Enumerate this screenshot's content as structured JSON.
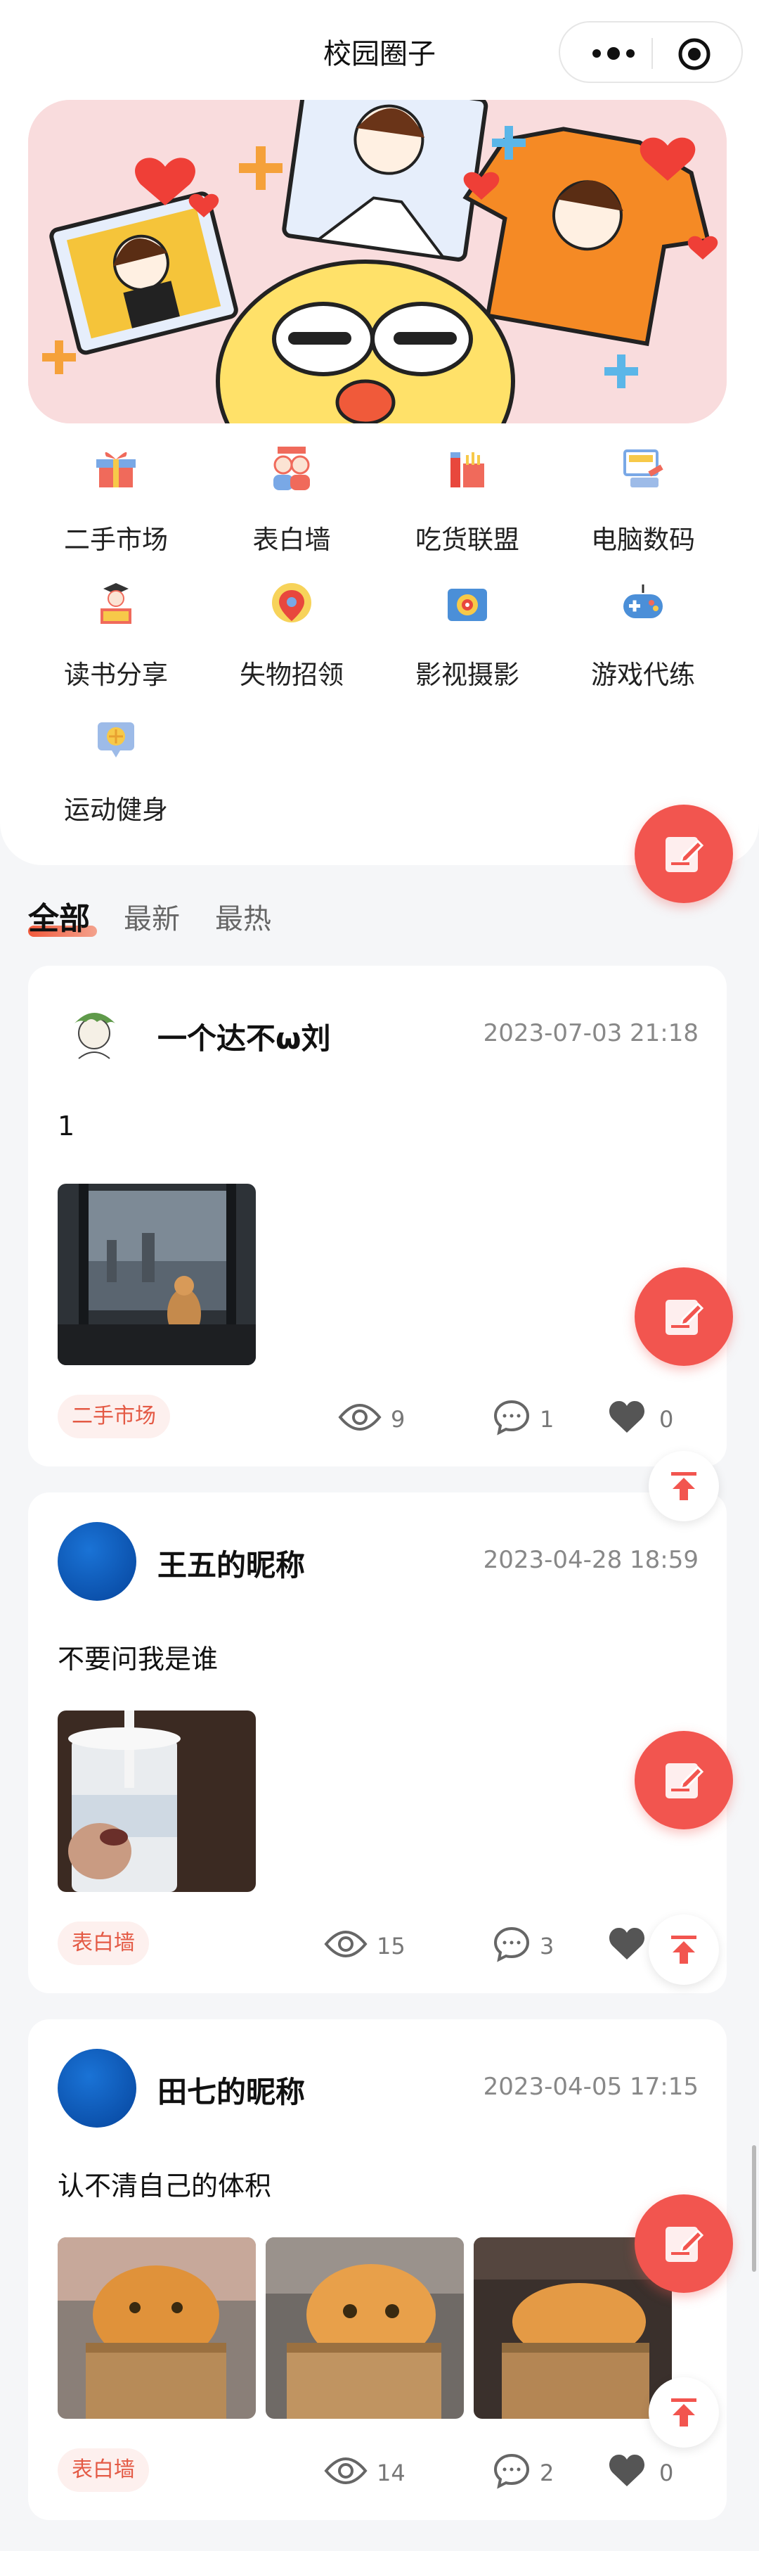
{
  "app": {
    "title": "校园圈子"
  },
  "categories": [
    {
      "label": "二手市场",
      "icon": "gift-icon"
    },
    {
      "label": "表白墙",
      "icon": "couple-icon"
    },
    {
      "label": "吃货联盟",
      "icon": "food-icon"
    },
    {
      "label": "电脑数码",
      "icon": "computer-icon"
    },
    {
      "label": "读书分享",
      "icon": "book-icon"
    },
    {
      "label": "失物招领",
      "icon": "location-icon"
    },
    {
      "label": "影视摄影",
      "icon": "camera-icon"
    },
    {
      "label": "游戏代练",
      "icon": "gamepad-icon"
    },
    {
      "label": "运动健身",
      "icon": "fitness-icon"
    }
  ],
  "tabs": [
    {
      "label": "全部",
      "active": true
    },
    {
      "label": "最新",
      "active": false
    },
    {
      "label": "最热",
      "active": false
    }
  ],
  "posts": [
    {
      "name": "一个达不ω刘",
      "date": "2023-07-03 21:18",
      "content": "1",
      "tag": "二手市场",
      "views": "9",
      "comments": "1",
      "likes": "0"
    },
    {
      "name": "王五的昵称",
      "date": "2023-04-28 18:59",
      "content": "不要问我是谁",
      "tag": "表白墙",
      "views": "15",
      "comments": "3",
      "likes": ""
    },
    {
      "name": "田七的昵称",
      "date": "2023-04-05 17:15",
      "content": "认不清自己的体积",
      "tag": "表白墙",
      "views": "14",
      "comments": "2",
      "likes": "0"
    }
  ],
  "colors": {
    "accent": "#f2554f",
    "tag_text": "#e45a45",
    "tag_bg": "#fdf0ee"
  }
}
